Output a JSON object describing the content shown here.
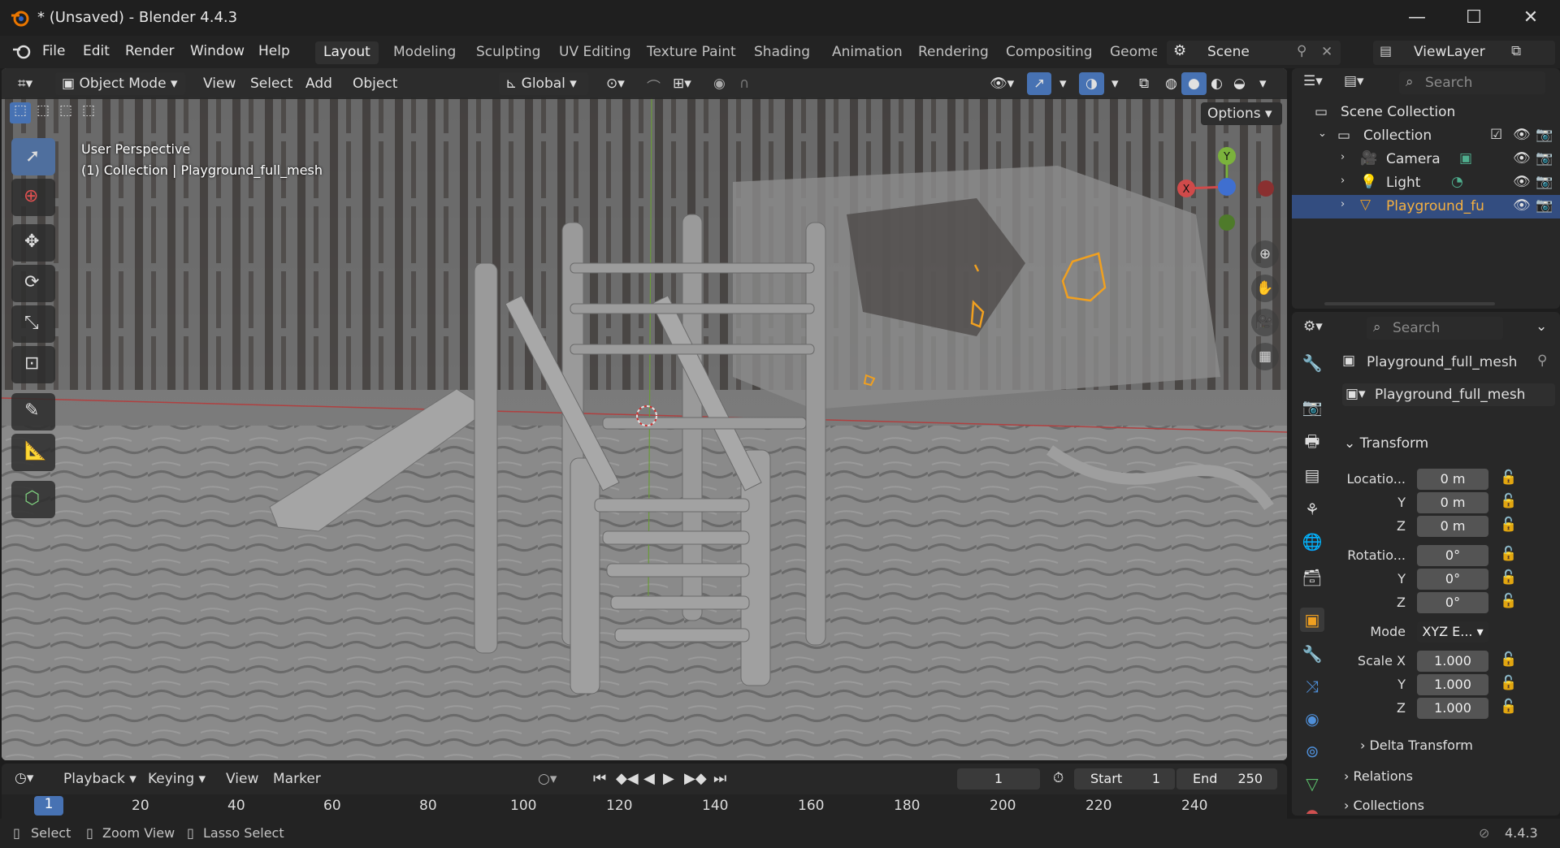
{
  "window": {
    "title": "* (Unsaved) - Blender 4.4.3"
  },
  "menu": {
    "file": "File",
    "edit": "Edit",
    "render": "Render",
    "window": "Window",
    "help": "Help"
  },
  "workspaces": [
    "Layout",
    "Modeling",
    "Sculpting",
    "UV Editing",
    "Texture Paint",
    "Shading",
    "Animation",
    "Rendering",
    "Compositing",
    "Geome"
  ],
  "scene": {
    "name": "Scene",
    "view_layer": "ViewLayer"
  },
  "viewport": {
    "mode": "Object Mode",
    "menus": [
      "View",
      "Select",
      "Add",
      "Object"
    ],
    "orientation": "Global",
    "options": "Options",
    "overlay_title": "User Perspective",
    "overlay_subtitle": "(1) Collection | Playground_full_mesh",
    "gizmo": {
      "x": "X",
      "y": "Y"
    }
  },
  "outliner": {
    "search_placeholder": "Search",
    "scene_collection": "Scene Collection",
    "collection": "Collection",
    "items": [
      {
        "label": "Camera",
        "color": "#e0854a"
      },
      {
        "label": "Light",
        "color": "#e0854a"
      },
      {
        "label": "Playground_fu",
        "color": "#e0854a"
      }
    ]
  },
  "properties": {
    "search_placeholder": "Search",
    "object_name": "Playground_full_mesh",
    "data_name": "Playground_full_mesh",
    "transform_header": "Transform",
    "location_label": "Locatio...",
    "location": [
      "0 m",
      "0 m",
      "0 m"
    ],
    "rotation_label": "Rotatio...",
    "rotation": [
      "0°",
      "0°",
      "0°"
    ],
    "mode_label": "Mode",
    "mode_value": "XYZ E...",
    "scale_label": "Scale X",
    "scale": [
      "1.000",
      "1.000",
      "1.000"
    ],
    "axis_y": "Y",
    "axis_z": "Z",
    "delta_transform": "Delta Transform",
    "relations": "Relations",
    "collections": "Collections"
  },
  "timeline": {
    "playback": "Playback",
    "keying": "Keying",
    "view": "View",
    "marker": "Marker",
    "current_frame": "1",
    "start_label": "Start",
    "start_value": "1",
    "end_label": "End",
    "end_value": "250",
    "ruler": [
      "20",
      "40",
      "60",
      "80",
      "100",
      "120",
      "140",
      "160",
      "180",
      "200",
      "220",
      "240"
    ],
    "ruler_current": "1"
  },
  "status": {
    "select": "Select",
    "zoom": "Zoom View",
    "lasso": "Lasso Select",
    "version": "4.4.3"
  },
  "colors": {
    "accent_blue": "#4772b3",
    "selection_orange": "#f0a020"
  }
}
